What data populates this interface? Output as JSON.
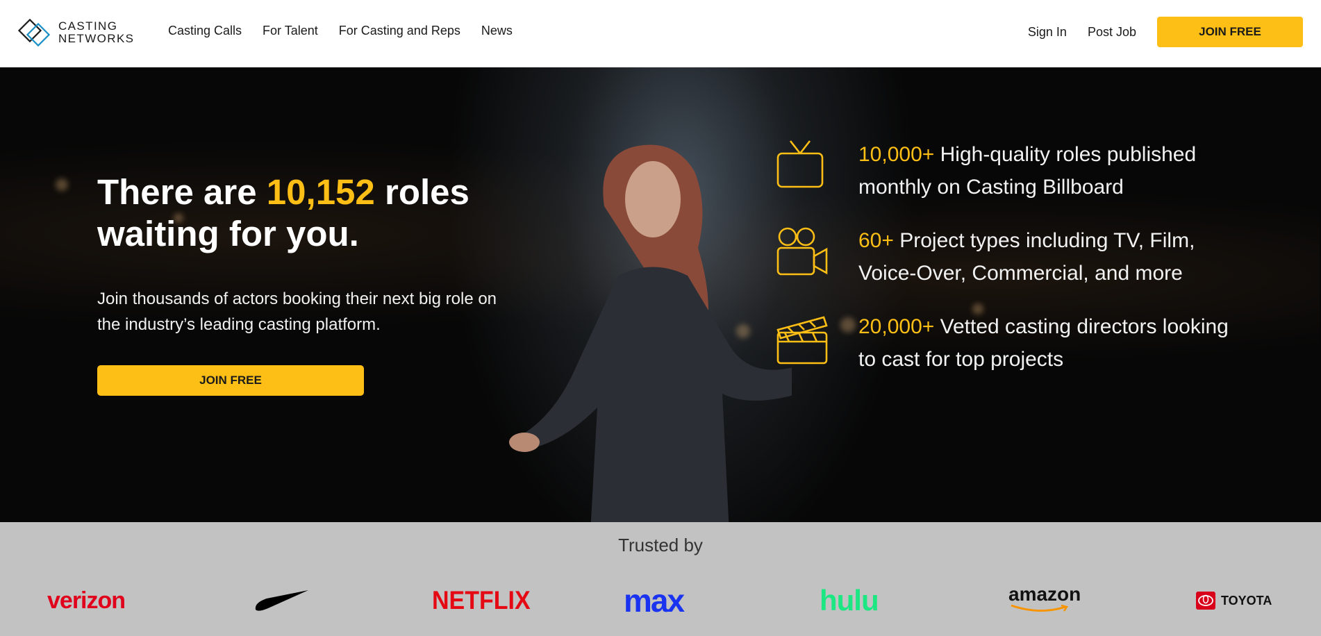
{
  "header": {
    "logo_line1": "CASTING",
    "logo_line2": "NETWORKS",
    "nav": [
      "Casting Calls",
      "For Talent",
      "For Casting and Reps",
      "News"
    ],
    "sign_in": "Sign In",
    "post_job": "Post Job",
    "join_label": "JOIN FREE"
  },
  "hero": {
    "headline_pre": "There are ",
    "headline_count": "10,152",
    "headline_post": " roles waiting for you.",
    "subtext": "Join thousands of actors booking their next big role on the industry’s leading casting platform.",
    "join_label": "JOIN FREE",
    "stats": [
      {
        "icon": "tv-icon",
        "number": "10,000+",
        "text": " High-quality roles published monthly on Casting Billboard"
      },
      {
        "icon": "video-camera-icon",
        "number": "60+",
        "text": " Project types including TV, Film, Voice-Over, Commercial, and more"
      },
      {
        "icon": "clapperboard-icon",
        "number": "20,000+",
        "text": " Vetted casting directors looking to cast for top projects"
      }
    ]
  },
  "trusted": {
    "title": "Trusted by",
    "brands": [
      {
        "name": "verizon",
        "color": "#e0001b"
      },
      {
        "name": "nike",
        "color": "#000000"
      },
      {
        "name": "NETFLIX",
        "color": "#e50914"
      },
      {
        "name": "max",
        "color": "#1a33f0"
      },
      {
        "name": "hulu",
        "color": "#1ce783"
      },
      {
        "name": "amazon",
        "color": "#111111"
      },
      {
        "name": "TOYOTA",
        "color": "#111111"
      }
    ]
  },
  "colors": {
    "accent": "#fdbf15",
    "hero_bg": "#070707",
    "trusted_bg": "#c2c2c2"
  }
}
